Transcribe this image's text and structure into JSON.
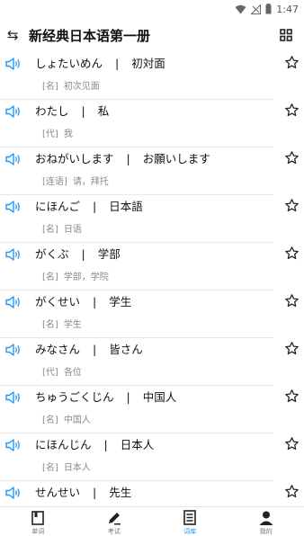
{
  "status": {
    "time": "1:47"
  },
  "header": {
    "title": "新经典日本语第一册"
  },
  "words": [
    {
      "kana": "しょたいめん",
      "kanji": "初対面",
      "pos": "[名]",
      "meaning": "初次见面"
    },
    {
      "kana": "わたし",
      "kanji": "私",
      "pos": "[代]",
      "meaning": "我"
    },
    {
      "kana": "おねがいします",
      "kanji": "お願いします",
      "pos": "[连语]",
      "meaning": "请，拜托"
    },
    {
      "kana": "にほんご",
      "kanji": "日本語",
      "pos": "[名]",
      "meaning": "日语"
    },
    {
      "kana": "がくぶ",
      "kanji": "学部",
      "pos": "[名]",
      "meaning": "学部，学院"
    },
    {
      "kana": "がくせい",
      "kanji": "学生",
      "pos": "[名]",
      "meaning": "学生"
    },
    {
      "kana": "みなさん",
      "kanji": "皆さん",
      "pos": "[代]",
      "meaning": "各位"
    },
    {
      "kana": "ちゅうごくじん",
      "kanji": "中国人",
      "pos": "[名]",
      "meaning": "中国人"
    },
    {
      "kana": "にほんじん",
      "kanji": "日本人",
      "pos": "[名]",
      "meaning": "日本人"
    },
    {
      "kana": "せんせい",
      "kanji": "先生",
      "pos": "",
      "meaning": ""
    }
  ],
  "separator": "|",
  "nav": [
    {
      "label": "单词",
      "icon": "book-icon"
    },
    {
      "label": "考试",
      "icon": "pencil-icon"
    },
    {
      "label": "词库",
      "icon": "wordbank-icon"
    },
    {
      "label": "我的",
      "icon": "person-icon"
    }
  ],
  "colors": {
    "accent": "#2196f3",
    "speaker": "#2196f3",
    "text": "#111111",
    "subtext": "#8a8a8a"
  }
}
